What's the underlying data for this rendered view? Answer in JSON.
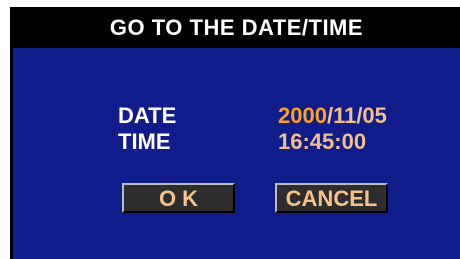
{
  "dialog": {
    "title": "GO TO THE DATE/TIME",
    "date": {
      "label": "DATE",
      "year": "2000",
      "rest": "/11/05"
    },
    "time": {
      "label": "TIME",
      "value": "16:45:00"
    },
    "buttons": {
      "ok": "O K",
      "cancel": "CANCEL"
    }
  },
  "colors": {
    "background": "#0f1c8a",
    "titlebar": "#000000",
    "value_text": "#f4c08a",
    "selected_field": "#ffa01e",
    "button_face": "#2d2d2d"
  }
}
